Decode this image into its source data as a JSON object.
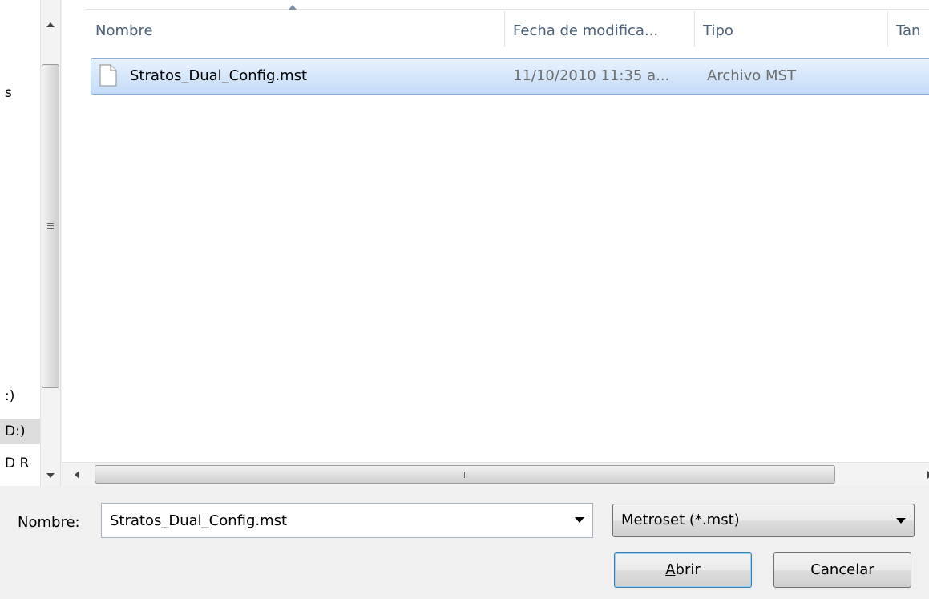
{
  "nav": {
    "items": [
      {
        "label": "s",
        "selected": false
      },
      {
        "label": ":)",
        "selected": false
      },
      {
        "label": "D:)",
        "selected": true
      },
      {
        "label": "D R",
        "selected": false
      }
    ]
  },
  "columns": [
    {
      "label": "Nombre"
    },
    {
      "label": "Fecha de modifica..."
    },
    {
      "label": "Tipo"
    },
    {
      "label": "Tan"
    }
  ],
  "files": [
    {
      "name": "Stratos_Dual_Config.mst",
      "modified": "11/10/2010 11:35 a...",
      "type": "Archivo MST",
      "icon": "document-icon"
    }
  ],
  "filename": {
    "label_prefix": "N",
    "label_accel": "o",
    "label_suffix": "mbre:",
    "value": "Stratos_Dual_Config.mst"
  },
  "filter": {
    "selected": "Metroset (*.mst)"
  },
  "buttons": {
    "open_accel": "A",
    "open_rest": "brir",
    "cancel": "Cancelar"
  },
  "colors": {
    "selection_border": "#84acdd",
    "header_text": "#4c607a",
    "default_button_border": "#3c7fb1"
  }
}
